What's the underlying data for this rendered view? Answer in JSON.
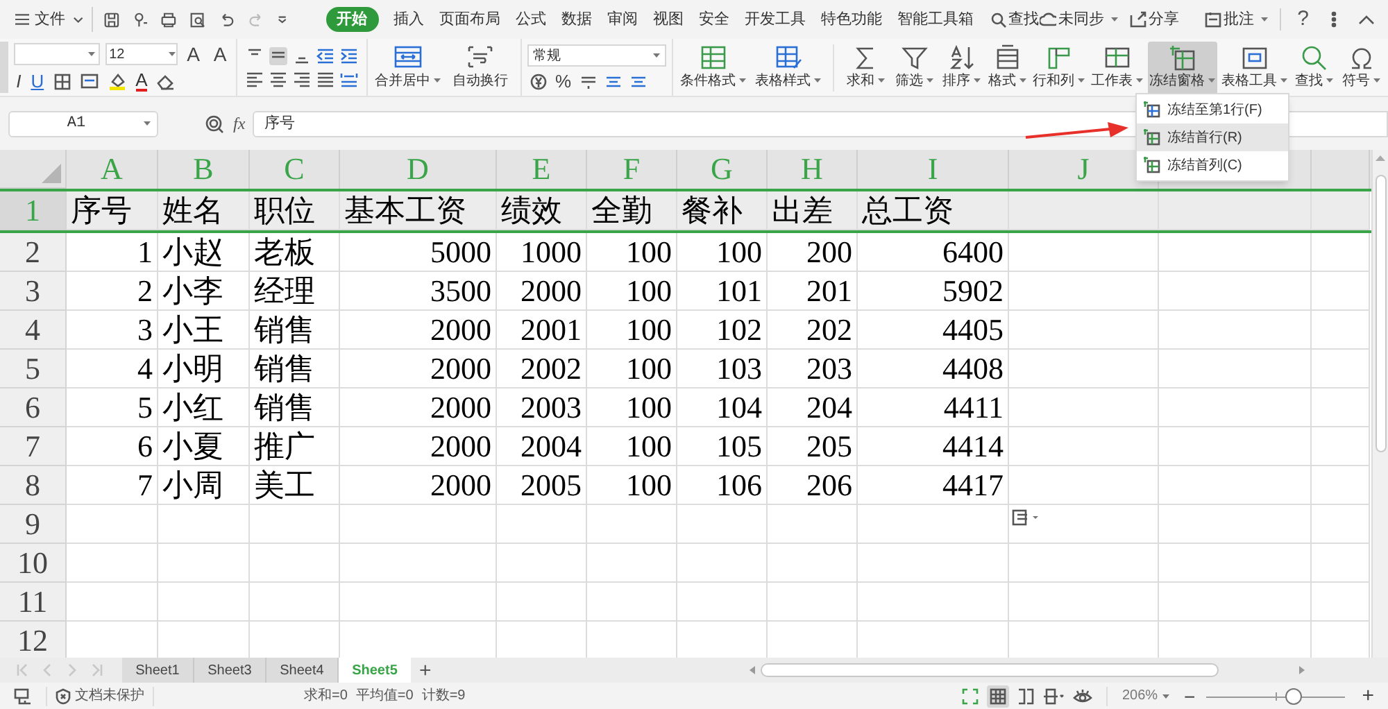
{
  "menu_bar": {
    "file_label": "文件",
    "tabs": [
      {
        "label": "开始",
        "selected": true
      },
      {
        "label": "插入",
        "selected": false
      },
      {
        "label": "页面布局",
        "selected": false
      },
      {
        "label": "公式",
        "selected": false
      },
      {
        "label": "数据",
        "selected": false
      },
      {
        "label": "审阅",
        "selected": false
      },
      {
        "label": "视图",
        "selected": false
      },
      {
        "label": "安全",
        "selected": false
      },
      {
        "label": "开发工具",
        "selected": false
      },
      {
        "label": "特色功能",
        "selected": false
      },
      {
        "label": "智能工具箱",
        "selected": false
      }
    ],
    "search": "查找",
    "actions": [
      {
        "label": "未同步",
        "dropdown": true
      },
      {
        "label": "分享",
        "dropdown": false
      },
      {
        "label": "批注",
        "dropdown": true
      }
    ],
    "help": "?"
  },
  "ribbon": {
    "font_size": "12",
    "font_size_buttons": [
      "A",
      "A"
    ],
    "style_buttons": [
      "I",
      "U"
    ],
    "font_color": "A",
    "merge_buttons": [
      "合并居中",
      "自动换行"
    ],
    "number_format": "常规",
    "percent": "%",
    "buttons": [
      {
        "label": "条件格式",
        "selected": false
      },
      {
        "label": "表格样式",
        "selected": false
      },
      {
        "label": "求和",
        "selected": false
      },
      {
        "label": "筛选",
        "selected": false
      },
      {
        "label": "排序",
        "selected": false
      },
      {
        "label": "格式",
        "selected": false
      },
      {
        "label": "行和列",
        "selected": false
      },
      {
        "label": "工作表",
        "selected": false
      },
      {
        "label": "冻结窗格",
        "selected": true
      },
      {
        "label": "表格工具",
        "selected": false
      },
      {
        "label": "查找",
        "selected": false
      },
      {
        "label": "符号",
        "selected": false
      }
    ]
  },
  "formula_bar": {
    "name_box": "A1",
    "fx": "fx",
    "formula": "序号"
  },
  "sheet": {
    "columns": [
      "A",
      "B",
      "C",
      "D",
      "E",
      "F",
      "G",
      "H",
      "I",
      "J"
    ],
    "rows": [
      {
        "number": "1",
        "selected": true,
        "cells": [
          "序号",
          "姓名",
          "职位",
          "基本工资",
          "绩效",
          "全勤",
          "餐补",
          "出差",
          "总工资"
        ]
      },
      {
        "number": "2",
        "selected": false,
        "cells": [
          "1",
          "小赵",
          "老板",
          "5000",
          "1000",
          "100",
          "100",
          "200",
          "6400"
        ]
      },
      {
        "number": "3",
        "selected": false,
        "cells": [
          "2",
          "小李",
          "经理",
          "3500",
          "2000",
          "100",
          "101",
          "201",
          "5902"
        ]
      },
      {
        "number": "4",
        "selected": false,
        "cells": [
          "3",
          "小王",
          "销售",
          "2000",
          "2001",
          "100",
          "102",
          "202",
          "4405"
        ]
      },
      {
        "number": "5",
        "selected": false,
        "cells": [
          "4",
          "小明",
          "销售",
          "2000",
          "2002",
          "100",
          "103",
          "203",
          "4408"
        ]
      },
      {
        "number": "6",
        "selected": false,
        "cells": [
          "5",
          "小红",
          "销售",
          "2000",
          "2003",
          "100",
          "104",
          "204",
          "4411"
        ]
      },
      {
        "number": "7",
        "selected": false,
        "cells": [
          "6",
          "小夏",
          "推广",
          "2000",
          "2004",
          "100",
          "105",
          "205",
          "4414"
        ]
      },
      {
        "number": "8",
        "selected": false,
        "cells": [
          "7",
          "小周",
          "美工",
          "2000",
          "2005",
          "100",
          "106",
          "206",
          "4417"
        ]
      },
      {
        "number": "9",
        "selected": false,
        "cells": []
      },
      {
        "number": "10",
        "selected": false,
        "cells": []
      },
      {
        "number": "11",
        "selected": false,
        "cells": []
      },
      {
        "number": "12",
        "selected": false,
        "cells": []
      }
    ]
  },
  "freeze_menu": [
    {
      "label": "冻结至第1行(F)",
      "selected": false
    },
    {
      "label": "冻结首行(R)",
      "selected": true
    },
    {
      "label": "冻结首列(C)",
      "selected": false
    }
  ],
  "sheet_tabs": [
    {
      "label": "Sheet1",
      "selected": false
    },
    {
      "label": "Sheet3",
      "selected": false
    },
    {
      "label": "Sheet4",
      "selected": false
    },
    {
      "label": "Sheet5",
      "selected": true
    }
  ],
  "add_sheet": "+",
  "status_bar": {
    "protection": "文档未保护",
    "stats": [
      "求和=0",
      "平均值=0",
      "计数=9"
    ],
    "zoom": "206%",
    "zoom_out": "−",
    "zoom_in": "+",
    "zoom_slider": {
      "level": 0.64
    }
  }
}
